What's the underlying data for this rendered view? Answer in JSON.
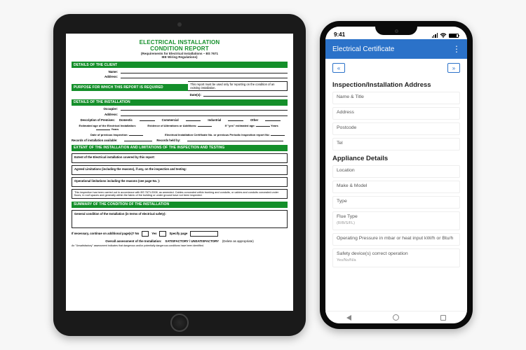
{
  "tablet": {
    "title1": "ELECTRICAL INSTALLATION",
    "title2": "CONDITION REPORT",
    "subtitle1": "(Requirements for Electrical Installations – BS 7671",
    "subtitle2": "IEE Wiring Regulations)",
    "sections": {
      "client": "DETAILS OF THE CLIENT",
      "purpose": "PURPOSE FOR WHICH THIS REPORT IS REQUIRED",
      "installation": "DETAILS OF THE INSTALLATION",
      "extent": "EXTENT OF THE INSTALLATION AND LIMITATIONS OF THE INSPECTION AND TESTING",
      "summary": "SUMMARY OF THE CONDITION OF THE INSTALLATION"
    },
    "labels": {
      "name": "Name:",
      "address": "Address:",
      "purpose_note": "This report must be used only for reporting on the condition of an existing installation.",
      "date": "Date(s):",
      "occupier": "Occupier:",
      "desc_premises": "Description of Premises:",
      "domestic": "Domestic",
      "commercial": "Commercial",
      "industrial": "Industrial",
      "other": "Other",
      "est_age": "Estimated age of the Electrical Installation:",
      "years": "Years",
      "evidence": "Evidence of Alterations or Additions:",
      "ifyes": "If \"yes\" estimated age:",
      "prev_inspection": "Date of previous Inspection:",
      "prev_cert": "Electrical Installation Certificate No. or previous Periodic Inspection report No:",
      "records_avail": "Records of installation available:",
      "records_held": "Records held by:",
      "extent_of": "Extent of the Electrical installation covered by this report:",
      "agreed_lim": "Agreed Limitations (including the reasons), if any, on the inspection and testing:",
      "op_lim": "Operational limitations including the reasons (see page No.    ):",
      "bs_note": "This inspection has been carried out in accordance with BS 7671:2008, as amended. Cables concealed within trunking and conduits, or cables and conduits concealed under floors, in roof spaces and generally within the fabric of the building or under ground have not been inspected.",
      "gen_cond": "General condition of the Installation (in terms of electrical safety):",
      "continue_q": "If necessary, continue on additional page(s)?   No",
      "yes": "Yes",
      "specify": "Specify page",
      "overall": "Overall assessment of the Installation:",
      "sat_unsat": "SATISFACTORY / UNSATISFACTORY",
      "delete": "(Delete as appropriate)",
      "footnote": "An \"Unsatisfactory\" assessment indicates that dangerous and/or potentially dangerous conditions have been identified."
    }
  },
  "phone": {
    "status_time": "9:41",
    "appbar_title": "Electrical Certificate",
    "nav_left": "«",
    "nav_right": "»",
    "section1": "Inspection/Installation Address",
    "section2": "Appliance Details",
    "fields": {
      "name_title": "Name & Title",
      "address": "Address",
      "postcode": "Postcode",
      "tel": "Tel",
      "location": "Location",
      "make_model": "Make & Model",
      "type": "Type",
      "flue_type": "Flue Type",
      "flue_type_sub": "(R/B/S/FL)",
      "op_pressure": "Operating Pressure in mbar or heat input kW/h or Btu/h",
      "safety": "Safety device(s) correct operation",
      "safety_sub": "Yes/No/N/a"
    }
  }
}
